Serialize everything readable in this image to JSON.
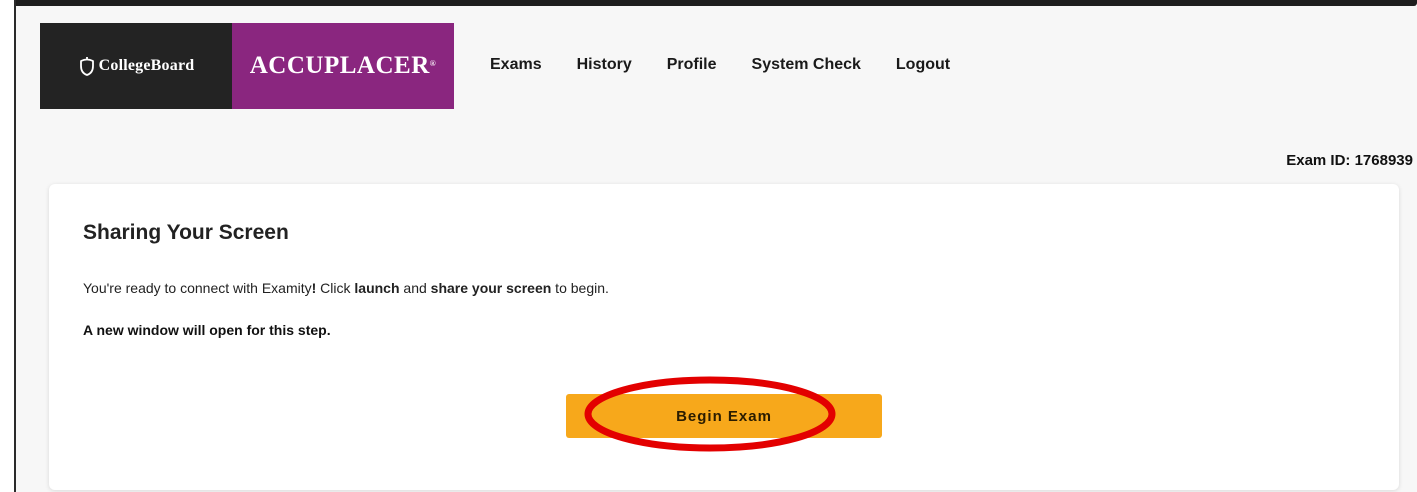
{
  "branding": {
    "collegeboard_text": "CollegeBoard",
    "accuplacer_text": "ACCUPLACER",
    "accuplacer_mark": "®",
    "colors": {
      "collegeboard_bg": "#232323",
      "accuplacer_bg": "#8a267f"
    }
  },
  "nav": {
    "items": [
      {
        "label": "Exams"
      },
      {
        "label": "History"
      },
      {
        "label": "Profile"
      },
      {
        "label": "System Check"
      },
      {
        "label": "Logout"
      }
    ]
  },
  "exam_id": "Exam ID: 1768939",
  "card": {
    "title": "Sharing Your Screen",
    "text_part1": "You're ready to connect with Examity",
    "text_bang": "!",
    "text_part2": " Click ",
    "text_launch": "launch",
    "text_part3": " and ",
    "text_share": "share your screen",
    "text_part4": " to begin.",
    "note": "A new window will open for this step.",
    "button_label": "Begin Exam",
    "button_color": "#f7a81b"
  },
  "annotation": {
    "shape": "ellipse",
    "color": "#e30000"
  }
}
